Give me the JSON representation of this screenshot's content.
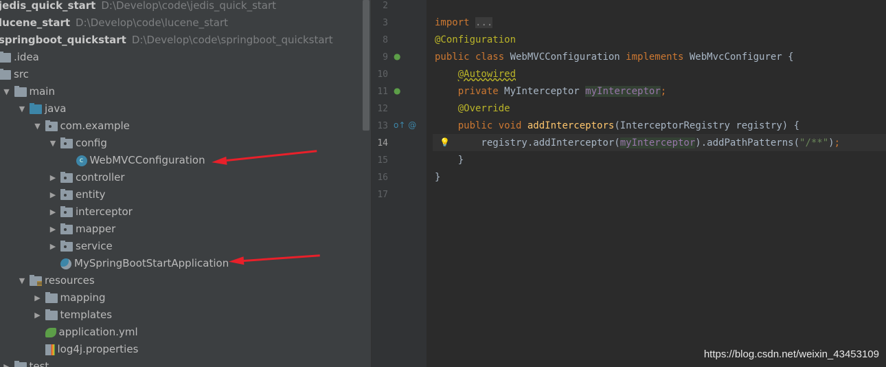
{
  "project_tree": {
    "items": [
      {
        "label": "jedis_quick_start",
        "path": "D:\\Develop\\code\\jedis_quick_start",
        "type": "project",
        "depth": 0
      },
      {
        "label": "lucene_start",
        "path": "D:\\Develop\\code\\lucene_start",
        "type": "project",
        "depth": 0
      },
      {
        "label": "springboot_quickstart",
        "path": "D:\\Develop\\code\\springboot_quickstart",
        "type": "project",
        "depth": 0
      },
      {
        "label": ".idea",
        "type": "folder",
        "depth": 0
      },
      {
        "label": "src",
        "type": "folder",
        "depth": 0
      },
      {
        "label": "main",
        "type": "folder",
        "depth": 1,
        "expanded": true
      },
      {
        "label": "java",
        "type": "src",
        "depth": 2,
        "expanded": true
      },
      {
        "label": "com.example",
        "type": "pkg",
        "depth": 3,
        "expanded": true
      },
      {
        "label": "config",
        "type": "pkg",
        "depth": 4,
        "expanded": true
      },
      {
        "label": "WebMVCConfiguration",
        "type": "class",
        "depth": 5,
        "highlighted": true
      },
      {
        "label": "controller",
        "type": "pkg",
        "depth": 4,
        "expanded": false
      },
      {
        "label": "entity",
        "type": "pkg",
        "depth": 4,
        "expanded": false
      },
      {
        "label": "interceptor",
        "type": "pkg",
        "depth": 4,
        "expanded": false
      },
      {
        "label": "mapper",
        "type": "pkg",
        "depth": 4,
        "expanded": false
      },
      {
        "label": "service",
        "type": "pkg",
        "depth": 4,
        "expanded": false
      },
      {
        "label": "MySpringBootStartApplication",
        "type": "app",
        "depth": 4,
        "highlighted": true
      },
      {
        "label": "resources",
        "type": "res",
        "depth": 2,
        "expanded": true
      },
      {
        "label": "mapping",
        "type": "folder",
        "depth": 3,
        "expanded": false
      },
      {
        "label": "templates",
        "type": "folder",
        "depth": 3,
        "expanded": false
      },
      {
        "label": "application.yml",
        "type": "yml",
        "depth": 3
      },
      {
        "label": "log4j.properties",
        "type": "props",
        "depth": 3
      },
      {
        "label": "test",
        "type": "folder",
        "depth": 1,
        "expanded": false
      }
    ]
  },
  "editor": {
    "current_line": 14,
    "lines": [
      {
        "n": "2",
        "tokens": []
      },
      {
        "n": "3",
        "tokens": [
          [
            "kw",
            "import "
          ],
          [
            "fold",
            "..."
          ]
        ]
      },
      {
        "n": "8",
        "tokens": [
          [
            "an",
            "@Configuration"
          ]
        ]
      },
      {
        "n": "9",
        "tokens": [
          [
            "kw",
            "public class "
          ],
          [
            "",
            "WebMVCConfiguration "
          ],
          [
            "kw",
            "implements "
          ],
          [
            "",
            "WebMvcConfigurer {"
          ]
        ],
        "gutter": "spring-bean-icon"
      },
      {
        "n": "10",
        "tokens": [
          [
            "",
            "    "
          ],
          [
            "an und",
            "@Autowired"
          ]
        ]
      },
      {
        "n": "11",
        "tokens": [
          [
            "",
            "    "
          ],
          [
            "kw",
            "private "
          ],
          [
            "",
            "MyInterceptor "
          ],
          [
            "fld",
            "myInterceptor"
          ],
          [
            "kw",
            ";"
          ]
        ],
        "gutter": "autowired-navigate-icon"
      },
      {
        "n": "12",
        "tokens": [
          [
            "",
            "    "
          ],
          [
            "an",
            "@Override"
          ]
        ]
      },
      {
        "n": "13",
        "tokens": [
          [
            "",
            "    "
          ],
          [
            "kw",
            "public void "
          ],
          [
            "fn",
            "addInterceptors"
          ],
          [
            "",
            "(InterceptorRegistry registry) {"
          ]
        ],
        "gutter": "override-method-icon"
      },
      {
        "n": "14",
        "tokens": [
          [
            "",
            "        registry.addInterceptor("
          ],
          [
            "fld",
            "myInterceptor"
          ],
          [
            "",
            ").addPathPatterns("
          ],
          [
            "str",
            "\"/**\""
          ],
          [
            "",
            ")"
          ],
          [
            "kw",
            ";"
          ]
        ],
        "gutter": "lightbulb-icon"
      },
      {
        "n": "15",
        "tokens": [
          [
            "",
            "    }"
          ]
        ]
      },
      {
        "n": "16",
        "tokens": [
          [
            "",
            "}"
          ]
        ]
      },
      {
        "n": "17",
        "tokens": []
      }
    ]
  },
  "annotation_color": "#e8202a",
  "watermark": "https://blog.csdn.net/weixin_43453109"
}
